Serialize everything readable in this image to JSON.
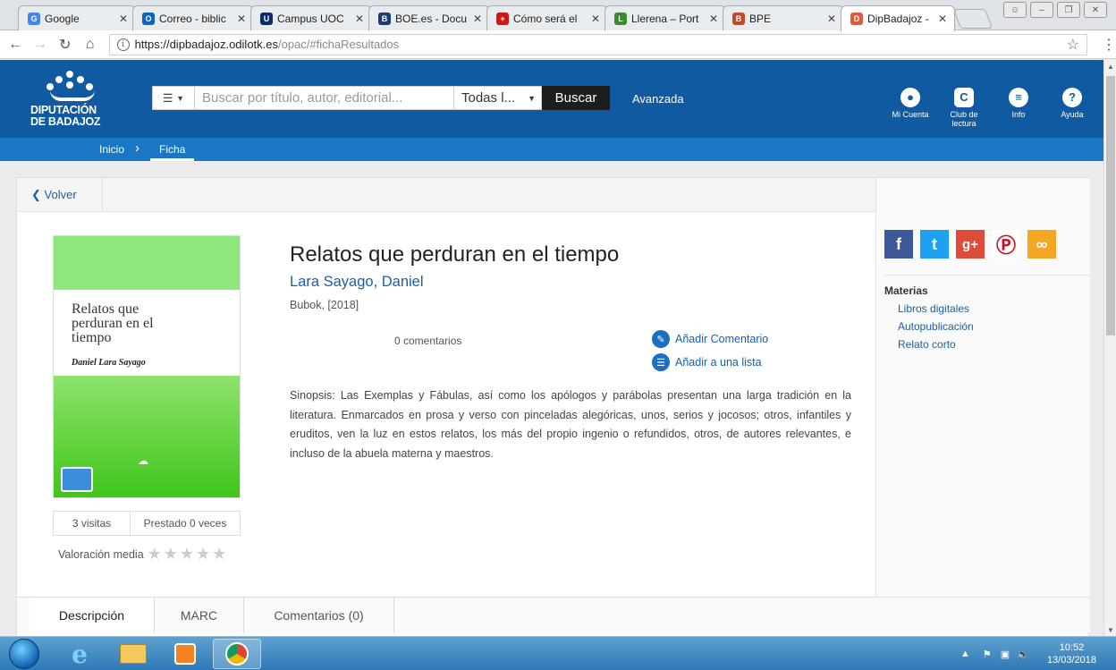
{
  "browser": {
    "tabs": [
      {
        "title": "Google",
        "favicon_color": "#4285f4",
        "favicon_text": "G",
        "active": false
      },
      {
        "title": "Correo - biblic",
        "favicon_color": "#0a64c4",
        "favicon_text": "O",
        "active": false
      },
      {
        "title": "Campus UOC",
        "favicon_color": "#0b2a6a",
        "favicon_text": "U",
        "active": false
      },
      {
        "title": "BOE.es - Docu",
        "favicon_color": "#1d3c72",
        "favicon_text": "B",
        "active": false
      },
      {
        "title": "Cómo será el",
        "favicon_color": "#d11616",
        "favicon_text": "+",
        "active": false
      },
      {
        "title": "Llerena – Port",
        "favicon_color": "#3b8a2b",
        "favicon_text": "L",
        "active": false
      },
      {
        "title": "BPE",
        "favicon_color": "#c24a2a",
        "favicon_text": "B",
        "active": false
      },
      {
        "title": "DipBadajoz - ",
        "favicon_color": "#e05a3c",
        "favicon_text": "D",
        "active": true
      }
    ],
    "tab_close_glyph": "✕",
    "url_host": "https://dipbadajoz.odilotk.es",
    "url_path": "/opac/#fichaResultados"
  },
  "header": {
    "logo_line1": "DIPUTACIÓN",
    "logo_line2": "DE BADAJOZ",
    "search_type_icon": "list-icon",
    "search_placeholder": "Buscar por título, autor, editorial...",
    "search_scope": "Todas l...",
    "search_button": "Buscar",
    "advanced": "Avanzada",
    "icons": [
      {
        "label": "Mi Cuenta",
        "icon": "user-icon",
        "glyph": "●"
      },
      {
        "label": "Club de lectura",
        "icon": "book-club-icon",
        "glyph": "C"
      },
      {
        "label": "Info",
        "icon": "menu-icon",
        "glyph": "≡"
      },
      {
        "label": "Ayuda",
        "icon": "help-icon",
        "glyph": "?"
      }
    ],
    "accent_color": "#0f5aa0"
  },
  "breadcrumb": {
    "home": "Inicio",
    "separator": "›",
    "current": "Ficha"
  },
  "record": {
    "back_label": "Volver",
    "cover_title": "Relatos que perduran en el tiempo",
    "cover_author": "Daniel Lara Sayago",
    "title": "Relatos que perduran en el tiempo",
    "author": "Lara Sayago, Daniel",
    "publisher": "Bubok, [2018]",
    "comments_count": "0 comentarios",
    "add_comment": "Añadir Comentario",
    "add_to_list": "Añadir a una lista",
    "synopsis": "Sinopsis: Las Exemplas y Fábulas, así como los apólogos y parábolas presentan una larga tradición en la literatura. Enmarcados en prosa y verso con pinceladas alegóricas, unos, serios y jocosos; otros, infantiles y eruditos, ven la luz en estos relatos, los más del propio ingenio o refundidos, otros, de autores relevantes, e incluso de la abuela materna y maestros.",
    "visits": "3 visitas",
    "loans": "Prestado 0 veces",
    "rating_label": "Valoración media",
    "rating_value": 0,
    "rating_max": 5
  },
  "sidebar": {
    "social": [
      {
        "name": "facebook-icon",
        "glyph": "f",
        "color": "#3b5998"
      },
      {
        "name": "twitter-icon",
        "glyph": "t",
        "color": "#1da1f2"
      },
      {
        "name": "google-plus-icon",
        "glyph": "g+",
        "color": "#dd4b39"
      },
      {
        "name": "pinterest-icon",
        "glyph": "p",
        "color": "#e0001a"
      },
      {
        "name": "link-icon",
        "glyph": "∞",
        "color": "#f5a623"
      }
    ],
    "materias_heading": "Materias",
    "materias": [
      "Libros digitales",
      "Autopublicación",
      "Relato corto"
    ]
  },
  "page_tabs": [
    "Descripción",
    "MARC",
    "Comentarios (0)"
  ],
  "taskbar": {
    "time": "10:52",
    "date": "13/03/2018"
  }
}
